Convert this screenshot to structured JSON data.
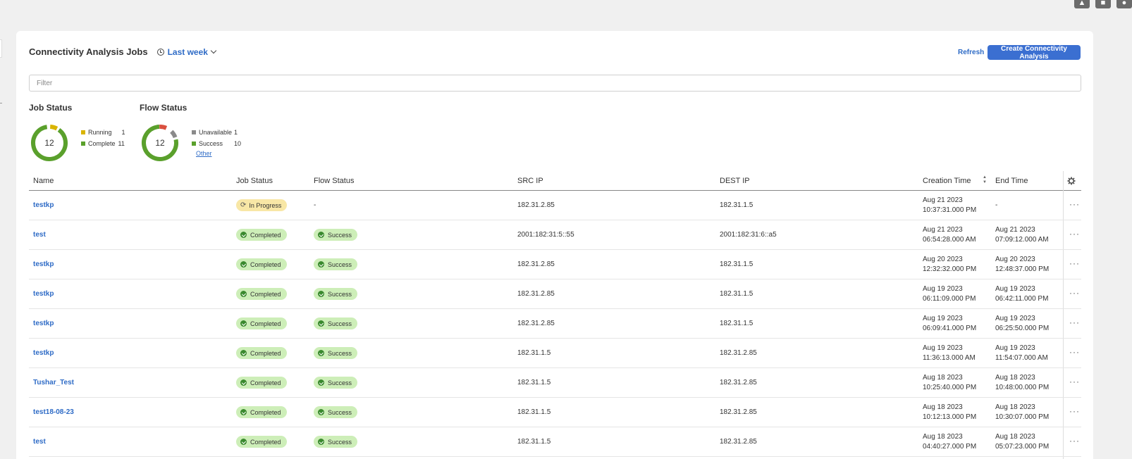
{
  "header": {
    "title": "Connectivity Analysis Jobs",
    "time_filter": "Last week",
    "refresh_label": "Refresh",
    "create_label": "Create Connectivity Analysis"
  },
  "filter": {
    "placeholder": "Filter",
    "value": ""
  },
  "job_status": {
    "title": "Job Status",
    "total": "12",
    "legend": [
      {
        "label": "Running",
        "count": "1",
        "color": "#d9b400"
      },
      {
        "label": "Complete",
        "count": "11",
        "color": "#5aa02c"
      }
    ]
  },
  "flow_status": {
    "title": "Flow Status",
    "total": "12",
    "legend": [
      {
        "label": "Unavailable",
        "count": "1",
        "color": "#8a8a8a"
      },
      {
        "label": "Success",
        "count": "10",
        "color": "#5aa02c"
      }
    ],
    "other_link": "Other",
    "other_color": "#d9503f"
  },
  "table": {
    "columns": {
      "name": "Name",
      "job_status": "Job Status",
      "flow_status": "Flow Status",
      "src_ip": "SRC IP",
      "dest_ip": "DEST IP",
      "creation_time": "Creation Time",
      "end_time": "End Time"
    },
    "rows": [
      {
        "name": "testkp",
        "job_status": "In Progress",
        "flow_status": "-",
        "src": "182.31.2.85",
        "dest": "182.31.1.5",
        "created_date": "Aug 21 2023",
        "created_time": "10:37:31.000 PM",
        "end_date": "-",
        "end_time": ""
      },
      {
        "name": "test",
        "job_status": "Completed",
        "flow_status": "Success",
        "src": "2001:182:31:5::55",
        "dest": "2001:182:31:6::a5",
        "created_date": "Aug 21 2023",
        "created_time": "06:54:28.000 AM",
        "end_date": "Aug 21 2023",
        "end_time": "07:09:12.000 AM"
      },
      {
        "name": "testkp",
        "job_status": "Completed",
        "flow_status": "Success",
        "src": "182.31.2.85",
        "dest": "182.31.1.5",
        "created_date": "Aug 20 2023",
        "created_time": "12:32:32.000 PM",
        "end_date": "Aug 20 2023",
        "end_time": "12:48:37.000 PM"
      },
      {
        "name": "testkp",
        "job_status": "Completed",
        "flow_status": "Success",
        "src": "182.31.2.85",
        "dest": "182.31.1.5",
        "created_date": "Aug 19 2023",
        "created_time": "06:11:09.000 PM",
        "end_date": "Aug 19 2023",
        "end_time": "06:42:11.000 PM"
      },
      {
        "name": "testkp",
        "job_status": "Completed",
        "flow_status": "Success",
        "src": "182.31.2.85",
        "dest": "182.31.1.5",
        "created_date": "Aug 19 2023",
        "created_time": "06:09:41.000 PM",
        "end_date": "Aug 19 2023",
        "end_time": "06:25:50.000 PM"
      },
      {
        "name": "testkp",
        "job_status": "Completed",
        "flow_status": "Success",
        "src": "182.31.1.5",
        "dest": "182.31.2.85",
        "created_date": "Aug 19 2023",
        "created_time": "11:36:13.000 AM",
        "end_date": "Aug 19 2023",
        "end_time": "11:54:07.000 AM"
      },
      {
        "name": "Tushar_Test",
        "job_status": "Completed",
        "flow_status": "Success",
        "src": "182.31.1.5",
        "dest": "182.31.2.85",
        "created_date": "Aug 18 2023",
        "created_time": "10:25:40.000 PM",
        "end_date": "Aug 18 2023",
        "end_time": "10:48:00.000 PM"
      },
      {
        "name": "test18-08-23",
        "job_status": "Completed",
        "flow_status": "Success",
        "src": "182.31.1.5",
        "dest": "182.31.2.85",
        "created_date": "Aug 18 2023",
        "created_time": "10:12:13.000 PM",
        "end_date": "Aug 18 2023",
        "end_time": "10:30:07.000 PM"
      },
      {
        "name": "test",
        "job_status": "Completed",
        "flow_status": "Success",
        "src": "182.31.1.5",
        "dest": "182.31.2.85",
        "created_date": "Aug 18 2023",
        "created_time": "04:40:27.000 PM",
        "end_date": "Aug 18 2023",
        "end_time": "05:07:23.000 PM"
      }
    ]
  }
}
